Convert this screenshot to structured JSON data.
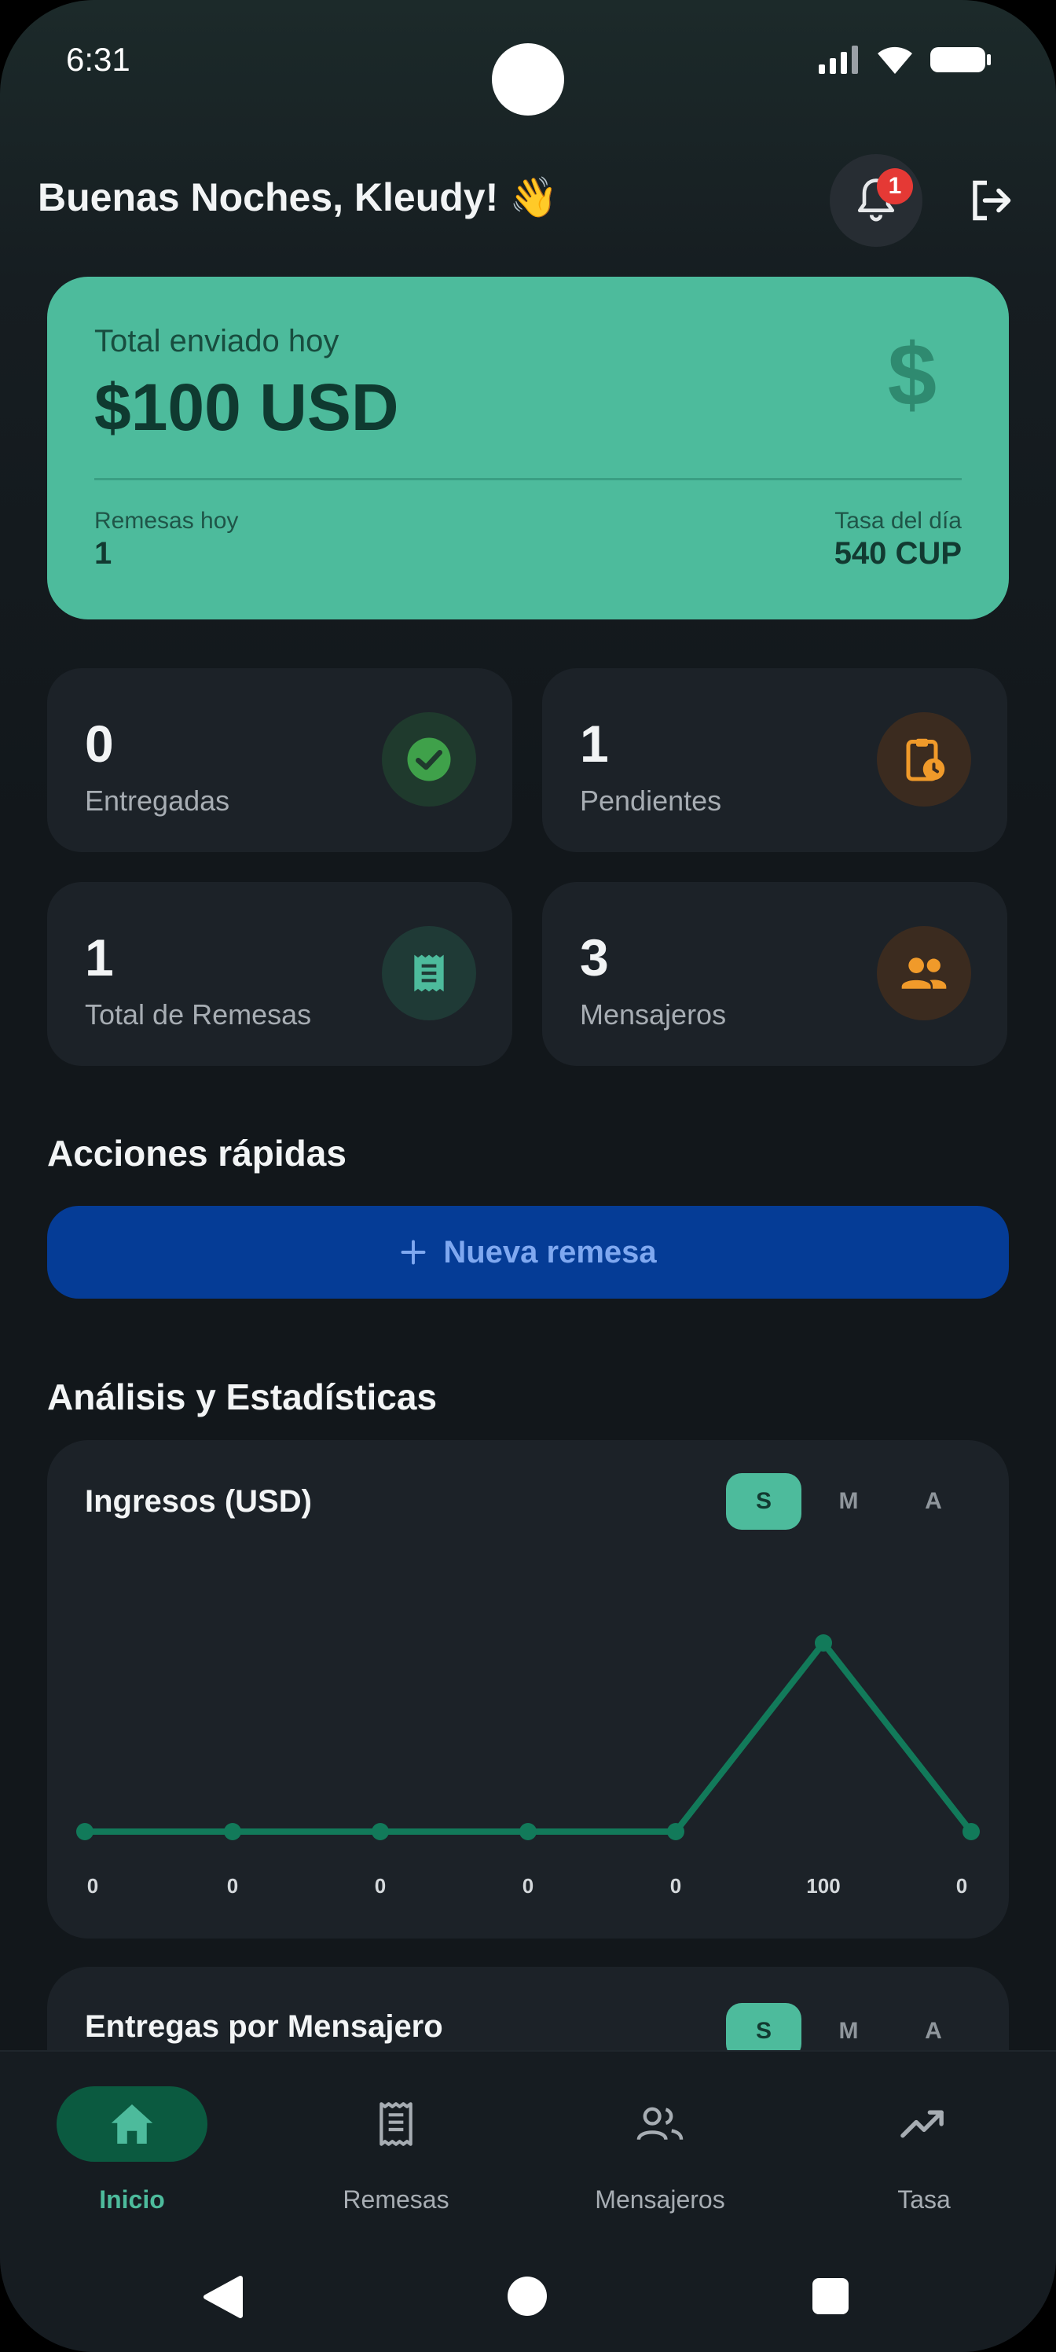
{
  "status_bar": {
    "time": "6:31"
  },
  "header": {
    "greeting": "Buenas Noches, Kleudy! 👋",
    "notification_count": "1"
  },
  "summary": {
    "label": "Total enviado hoy",
    "amount": "$100 USD",
    "currency_symbol": "$",
    "remesas_label": "Remesas hoy",
    "remesas_value": "1",
    "tasa_label": "Tasa del día",
    "tasa_value": "540 CUP"
  },
  "stats": [
    {
      "value": "0",
      "label": "Entregadas",
      "icon": "check-circle-icon"
    },
    {
      "value": "1",
      "label": "Pendientes",
      "icon": "clipboard-clock-icon"
    },
    {
      "value": "1",
      "label": "Total de Remesas",
      "icon": "receipt-icon"
    },
    {
      "value": "3",
      "label": "Mensajeros",
      "icon": "people-icon"
    }
  ],
  "quick_actions": {
    "title": "Acciones rápidas",
    "new_button": "Nueva remesa"
  },
  "analytics": {
    "title": "Análisis y Estadísticas"
  },
  "chart_data": [
    {
      "type": "line",
      "title": "Ingresos (USD)",
      "x": [
        "",
        "",
        "",
        "",
        "",
        "",
        ""
      ],
      "values": [
        0,
        0,
        0,
        0,
        0,
        100,
        0
      ],
      "data_labels": [
        "0",
        "0",
        "0",
        "0",
        "0",
        "100",
        "0"
      ],
      "ylim": [
        0,
        120
      ],
      "grid": false,
      "color": "#127a5a",
      "period_options": [
        "S",
        "M",
        "A"
      ],
      "selected_period": "S"
    },
    {
      "type": "bar",
      "title": "Entregas por Mensajero",
      "period_options": [
        "S",
        "M",
        "A"
      ],
      "selected_period": "S"
    }
  ],
  "bottom_nav": [
    {
      "label": "Inicio",
      "icon": "home-icon",
      "active": true
    },
    {
      "label": "Remesas",
      "icon": "receipt-icon",
      "active": false
    },
    {
      "label": "Mensajeros",
      "icon": "people-icon",
      "active": false
    },
    {
      "label": "Tasa",
      "icon": "trending-up-icon",
      "active": false
    }
  ],
  "colors": {
    "accent": "#4dbb9c",
    "primary_button": "#053c96",
    "background": "#12171b",
    "card": "#1c2228",
    "badge": "#e53935"
  }
}
